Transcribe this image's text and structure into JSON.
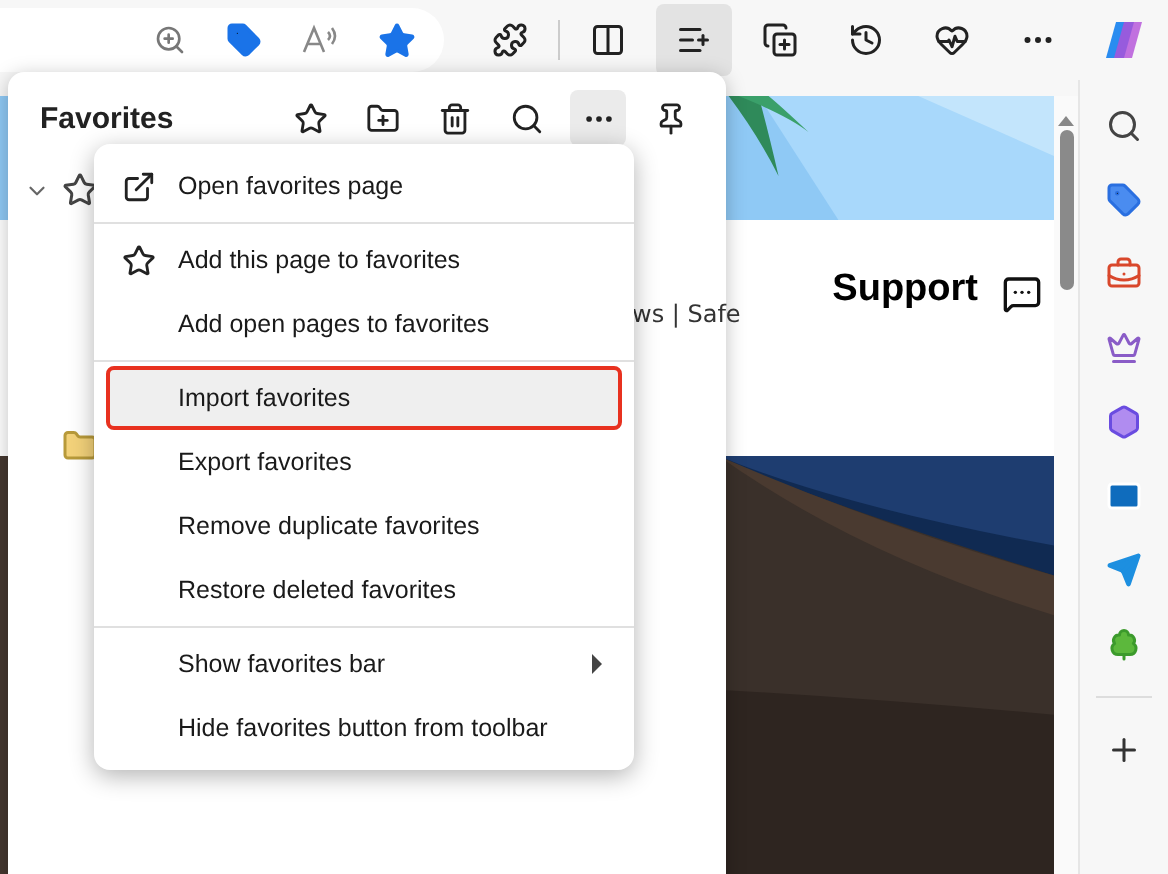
{
  "toolbar": {
    "favorites_button": {
      "selected": true
    }
  },
  "page": {
    "heading": "Support",
    "snippet": "ws | Safe"
  },
  "favorites_panel": {
    "title": "Favorites",
    "more_button": {
      "selected": true
    },
    "tree": {
      "expanded": true
    }
  },
  "menu": {
    "groups": [
      [
        {
          "label": "Open favorites page",
          "has_submenu": false,
          "highlighted": false
        }
      ],
      [
        {
          "label": "Add this page to favorites",
          "has_submenu": false,
          "highlighted": false
        },
        {
          "label": "Add open pages to favorites",
          "has_submenu": false,
          "highlighted": false
        }
      ],
      [
        {
          "label": "Import favorites",
          "has_submenu": false,
          "highlighted": true
        },
        {
          "label": "Export favorites",
          "has_submenu": false,
          "highlighted": false
        },
        {
          "label": "Remove duplicate favorites",
          "has_submenu": false,
          "highlighted": false
        },
        {
          "label": "Restore deleted favorites",
          "has_submenu": false,
          "highlighted": false
        }
      ],
      [
        {
          "label": "Show favorites bar",
          "has_submenu": true,
          "highlighted": false
        },
        {
          "label": "Hide favorites button from toolbar",
          "has_submenu": false,
          "highlighted": false
        }
      ]
    ]
  }
}
